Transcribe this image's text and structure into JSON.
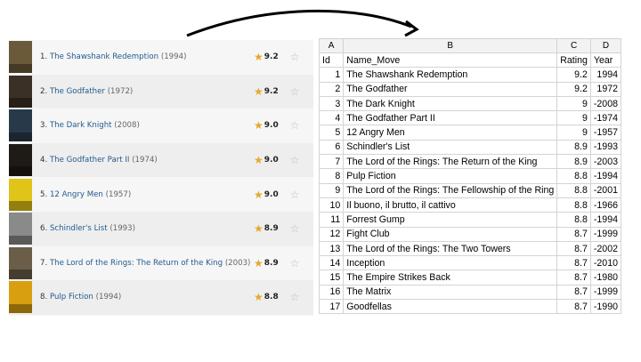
{
  "colors": {
    "arrow": "#000000",
    "link": "#1f5a8e",
    "star_filled": "#e8a828",
    "star_empty": "#bbbbbb"
  },
  "imdb_list": [
    {
      "rank": "1.",
      "title": "The Shawshank Redemption",
      "year": "(1994)",
      "rating": "9.2",
      "poster_color": "#6b5a3a",
      "star_icon": "star-icon",
      "rate_icon": "empty-star-icon"
    },
    {
      "rank": "2.",
      "title": "The Godfather",
      "year": "(1972)",
      "rating": "9.2",
      "poster_color": "#3a3026",
      "star_icon": "star-icon",
      "rate_icon": "empty-star-icon"
    },
    {
      "rank": "3.",
      "title": "The Dark Knight",
      "year": "(2008)",
      "rating": "9.0",
      "poster_color": "#283a4a",
      "star_icon": "star-icon",
      "rate_icon": "empty-star-icon"
    },
    {
      "rank": "4.",
      "title": "The Godfather Part II",
      "year": "(1974)",
      "rating": "9.0",
      "poster_color": "#1e1a16",
      "star_icon": "star-icon",
      "rate_icon": "empty-star-icon"
    },
    {
      "rank": "5.",
      "title": "12 Angry Men",
      "year": "(1957)",
      "rating": "9.0",
      "poster_color": "#e0c418",
      "star_icon": "star-icon",
      "rate_icon": "empty-star-icon"
    },
    {
      "rank": "6.",
      "title": "Schindler's List",
      "year": "(1993)",
      "rating": "8.9",
      "poster_color": "#8a8a8a",
      "star_icon": "star-icon",
      "rate_icon": "empty-star-icon"
    },
    {
      "rank": "7.",
      "title": "The Lord of the Rings: The Return of the King",
      "year": "(2003)",
      "rating": "8.9",
      "poster_color": "#6a5e48",
      "star_icon": "star-icon",
      "rate_icon": "empty-star-icon"
    },
    {
      "rank": "8.",
      "title": "Pulp Fiction",
      "year": "(1994)",
      "rating": "8.8",
      "poster_color": "#d8a010",
      "star_icon": "star-icon",
      "rate_icon": "empty-star-icon"
    }
  ],
  "sheet": {
    "columns": [
      "A",
      "B",
      "C",
      "D"
    ],
    "header": [
      "Id",
      "Name_Move",
      "Rating",
      "Year"
    ],
    "rows": [
      [
        "1",
        "The Shawshank Redemption",
        "9.2",
        "1994"
      ],
      [
        "2",
        "The Godfather",
        "9.2",
        "1972"
      ],
      [
        "3",
        "The Dark Knight",
        "9",
        "-2008"
      ],
      [
        "4",
        "The Godfather Part II",
        "9",
        "-1974"
      ],
      [
        "5",
        "12 Angry Men",
        "9",
        "-1957"
      ],
      [
        "6",
        "Schindler's List",
        "8.9",
        "-1993"
      ],
      [
        "7",
        "The Lord of the Rings: The Return of the King",
        "8.9",
        "-2003"
      ],
      [
        "8",
        "Pulp Fiction",
        "8.8",
        "-1994"
      ],
      [
        "9",
        "The Lord of the Rings: The Fellowship of the Ring",
        "8.8",
        "-2001"
      ],
      [
        "10",
        "Il buono, il brutto, il cattivo",
        "8.8",
        "-1966"
      ],
      [
        "11",
        "Forrest Gump",
        "8.8",
        "-1994"
      ],
      [
        "12",
        "Fight Club",
        "8.7",
        "-1999"
      ],
      [
        "13",
        "The Lord of the Rings: The Two Towers",
        "8.7",
        "-2002"
      ],
      [
        "14",
        "Inception",
        "8.7",
        "-2010"
      ],
      [
        "15",
        "The Empire Strikes Back",
        "8.7",
        "-1980"
      ],
      [
        "16",
        "The Matrix",
        "8.7",
        "-1999"
      ],
      [
        "17",
        "Goodfellas",
        "8.7",
        "-1990"
      ]
    ]
  }
}
